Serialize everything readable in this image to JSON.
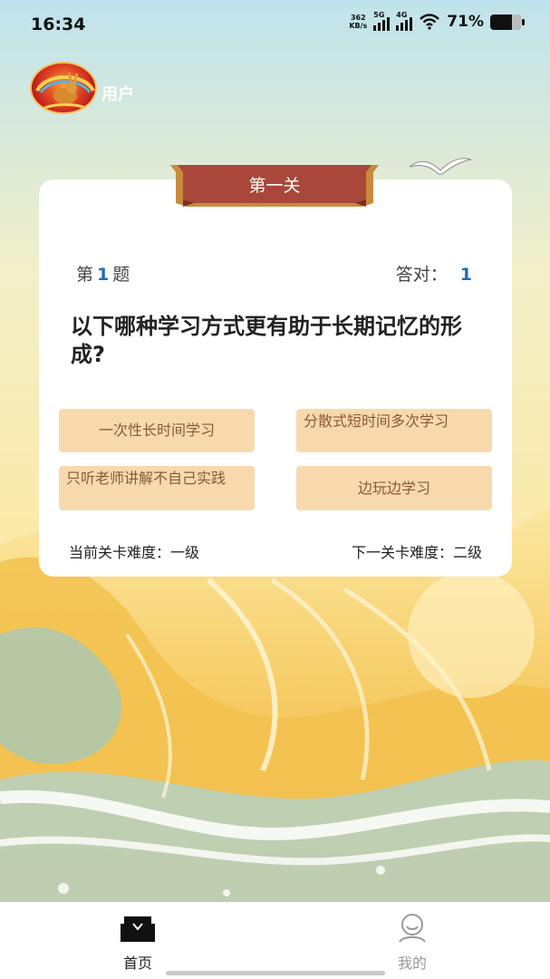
{
  "status_bar": {
    "time": "16:34",
    "net_speed_value": "362",
    "net_speed_unit": "KB/s",
    "signal_1_label": "5G",
    "signal_2_label": "4G",
    "battery_percent": "71%",
    "battery_level": 0.71
  },
  "user": {
    "name": "用户"
  },
  "quiz": {
    "level_title": "第一关",
    "question_prefix": "第",
    "question_number": "1",
    "question_suffix": "题",
    "correct_label": "答对：",
    "correct_count": "1",
    "question_text": "以下哪种学习方式更有助于长期记忆的形成?",
    "options": [
      {
        "label": "一次性长时间学习"
      },
      {
        "label": "分散式短时间多次学习"
      },
      {
        "label": "只听老师讲解不自己实践"
      },
      {
        "label": "边玩边学习"
      }
    ],
    "current_difficulty": "当前关卡难度：一级",
    "next_difficulty": "下一关卡难度：二级"
  },
  "nav": {
    "home_label": "首页",
    "mine_label": "我的"
  },
  "colors": {
    "accent_blue": "#1c6fb5",
    "option_bg": "#f8d9ae",
    "option_text": "#8a5a34",
    "banner": "#a8473a"
  }
}
